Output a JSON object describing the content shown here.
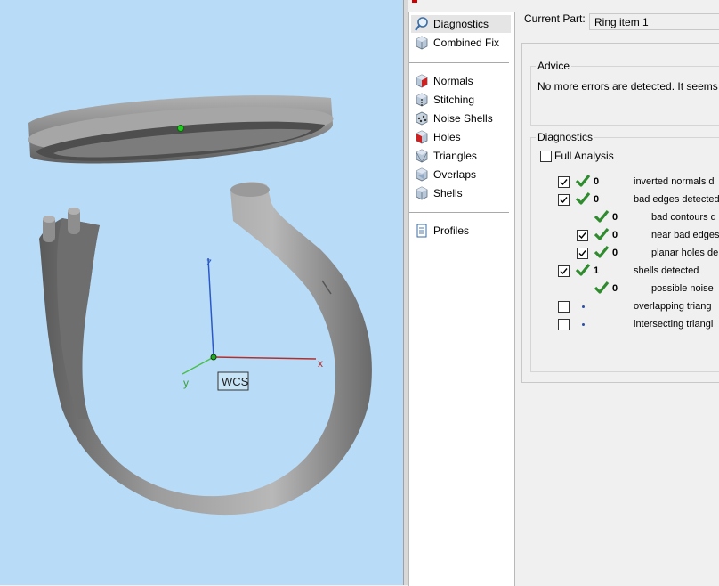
{
  "viewport": {
    "axis_labels": {
      "z": "z",
      "x": "x",
      "y": "y"
    },
    "wcs_label": "WCS",
    "background_color": "#b8dcf7",
    "model_color": "#8c8c8c"
  },
  "nav": {
    "group1": [
      {
        "label": "Diagnostics",
        "icon": "magnifier-icon",
        "selected": true
      },
      {
        "label": "Combined Fix",
        "icon": "cube-icon",
        "selected": false
      }
    ],
    "group2": [
      {
        "label": "Normals",
        "icon": "normals-cube-icon"
      },
      {
        "label": "Stitching",
        "icon": "stitching-cube-icon"
      },
      {
        "label": "Noise Shells",
        "icon": "noise-shells-cube-icon"
      },
      {
        "label": "Holes",
        "icon": "holes-cube-icon"
      },
      {
        "label": "Triangles",
        "icon": "triangles-cube-icon"
      },
      {
        "label": "Overlaps",
        "icon": "overlaps-cube-icon"
      },
      {
        "label": "Shells",
        "icon": "shells-cube-icon"
      }
    ],
    "group3": [
      {
        "label": "Profiles",
        "icon": "document-icon"
      }
    ]
  },
  "current_part": {
    "label": "Current Part:",
    "value": "Ring item 1"
  },
  "advice": {
    "title": "Advice",
    "text": "No more errors are detected. It seems t"
  },
  "diagnostics": {
    "title": "Diagnostics",
    "full_analysis_label": "Full Analysis",
    "full_analysis_checked": false,
    "rows": [
      {
        "checkbox": true,
        "checked": true,
        "status": "check",
        "count": "0",
        "label": "inverted normals d",
        "indent": 0
      },
      {
        "checkbox": true,
        "checked": true,
        "status": "check",
        "count": "0",
        "label": "bad edges detected",
        "indent": 0
      },
      {
        "checkbox": false,
        "checked": false,
        "status": "check",
        "count": "0",
        "label": "bad contours d",
        "indent": 2
      },
      {
        "checkbox": true,
        "checked": true,
        "status": "check",
        "count": "0",
        "label": "near bad edges",
        "indent": 1
      },
      {
        "checkbox": true,
        "checked": true,
        "status": "check",
        "count": "0",
        "label": "planar holes de",
        "indent": 1
      },
      {
        "checkbox": true,
        "checked": true,
        "status": "check",
        "count": "1",
        "label": "shells detected",
        "indent": 0
      },
      {
        "checkbox": false,
        "checked": false,
        "status": "check",
        "count": "0",
        "label": "possible noise",
        "indent": 2
      },
      {
        "checkbox": true,
        "checked": false,
        "status": "dot",
        "count": "",
        "label": "overlapping triang",
        "indent": 0
      },
      {
        "checkbox": true,
        "checked": false,
        "status": "dot",
        "count": "",
        "label": "intersecting triangl",
        "indent": 0
      }
    ]
  }
}
